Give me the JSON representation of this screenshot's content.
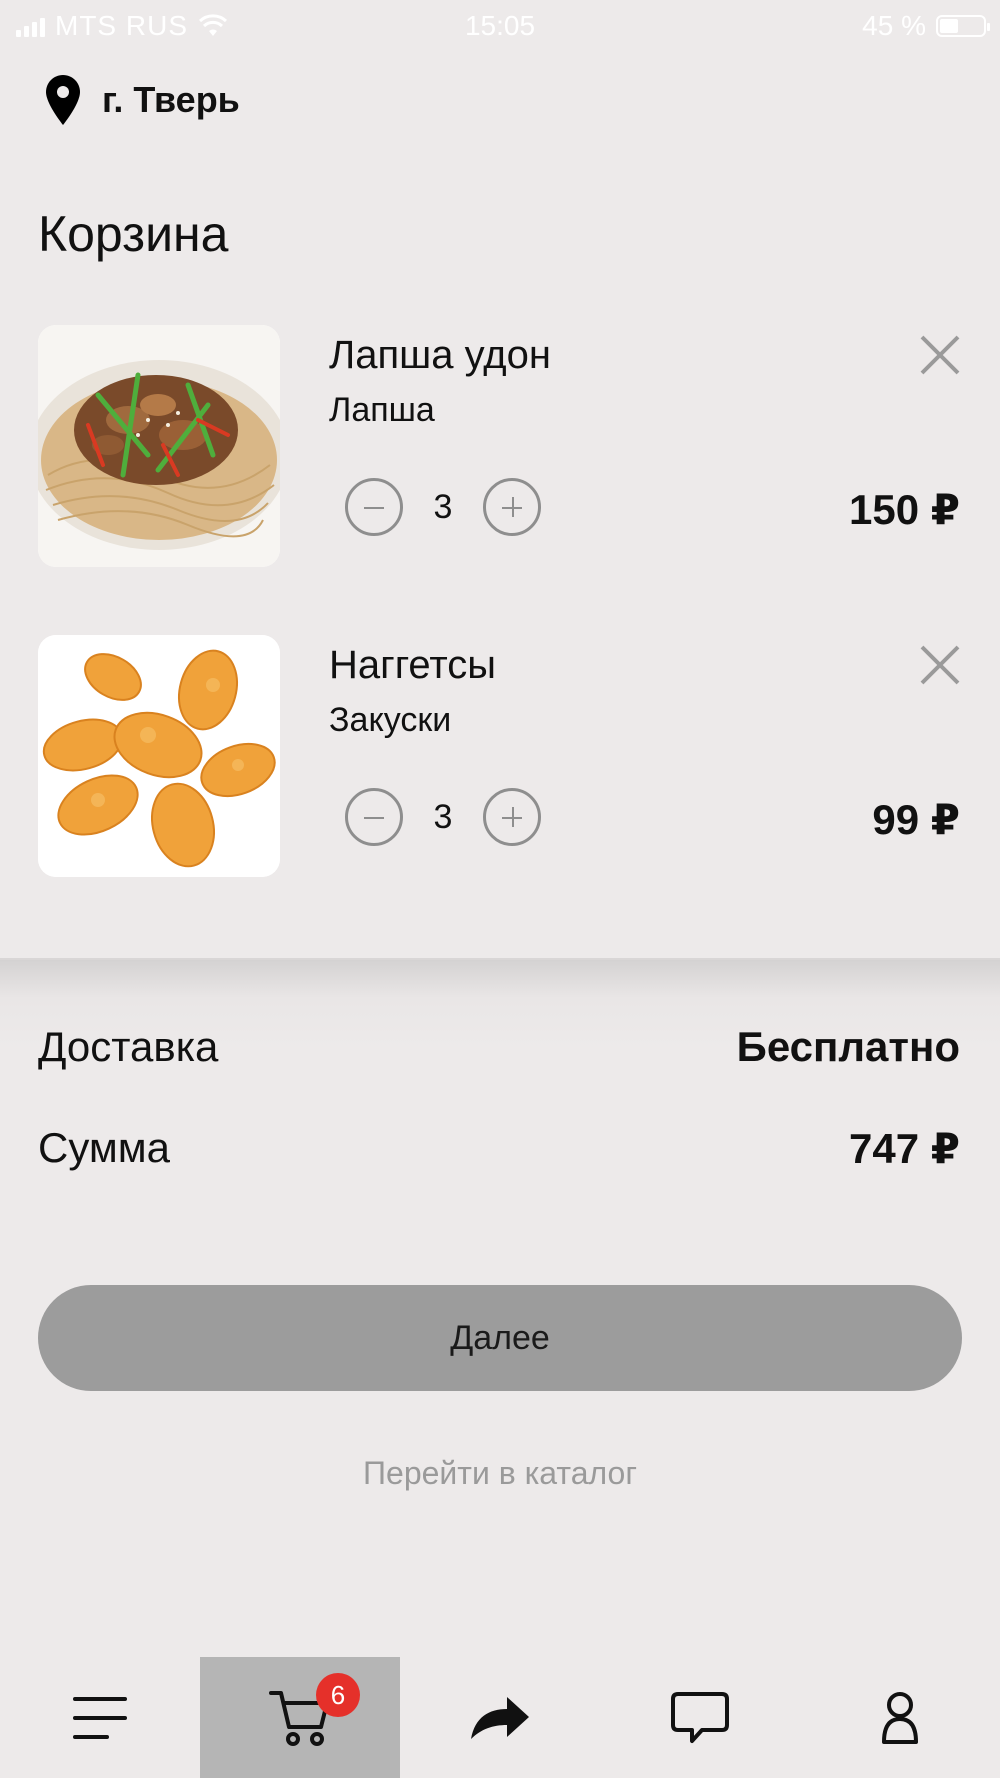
{
  "status_bar": {
    "carrier": "MTS RUS",
    "time": "15:05",
    "battery": "45 %",
    "battery_level": 0.45
  },
  "location": {
    "city": "г. Тверь",
    "icon": "location-pin-icon"
  },
  "page": {
    "title": "Корзина"
  },
  "cart": {
    "items": [
      {
        "name": "Лапша удон",
        "category": "Лапша",
        "quantity": "3",
        "price": "150 ₽"
      },
      {
        "name": "Наггетсы",
        "category": "Закуски",
        "quantity": "3",
        "price": "99 ₽"
      }
    ]
  },
  "summary": {
    "delivery_label": "Доставка",
    "delivery_value": "Бесплатно",
    "total_label": "Сумма",
    "total_value": "747 ₽"
  },
  "actions": {
    "next_label": "Далее",
    "catalog_label": "Перейти в каталог"
  },
  "tabbar": {
    "tabs": [
      {
        "icon": "menu-icon"
      },
      {
        "icon": "cart-icon",
        "badge": "6",
        "active": true
      },
      {
        "icon": "share-icon"
      },
      {
        "icon": "chat-icon"
      },
      {
        "icon": "profile-icon"
      }
    ]
  },
  "colors": {
    "background": "#edeaea",
    "button": "#9c9c9c",
    "badge": "#e5302a",
    "active_tab": "#b5b5b5",
    "muted_text": "#9a9a9a"
  }
}
